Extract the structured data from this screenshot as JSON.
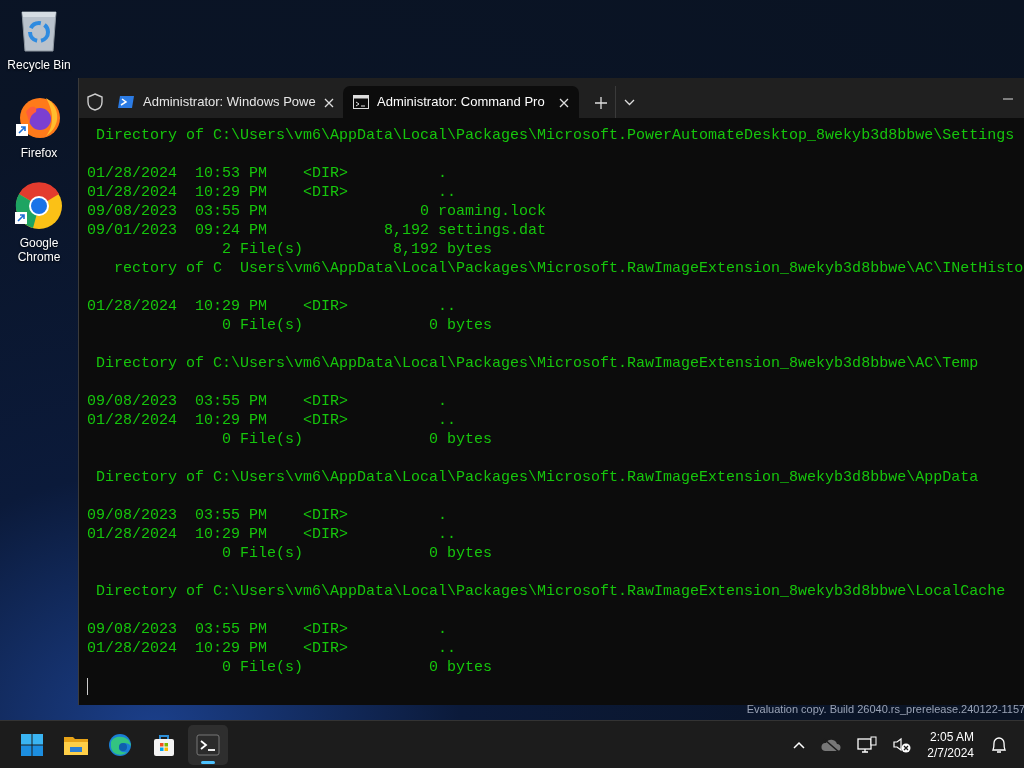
{
  "desktop": {
    "icons": [
      {
        "kind": "recycle-bin",
        "label": "Recycle Bin",
        "shortcut": false
      },
      {
        "kind": "firefox",
        "label": "Firefox",
        "shortcut": true
      },
      {
        "kind": "chrome",
        "label": "Google Chrome",
        "shortcut": true
      }
    ],
    "build_notice": "Evaluation copy. Build 26040.rs_prerelease.240122-1157"
  },
  "terminal": {
    "tabs": [
      {
        "kind": "powershell",
        "title": "Administrator: Windows Powe",
        "selected": false
      },
      {
        "kind": "cmd",
        "title": "Administrator: Command Pro",
        "selected": true
      }
    ],
    "blocks": [
      [
        " Directory of C:\\Users\\vm6\\AppData\\Local\\Packages\\Microsoft.PowerAutomateDesktop_8wekyb3d8bbwe\\Settings"
      ],
      [
        "01/28/2024  10:53 PM    <DIR>          .",
        "01/28/2024  10:29 PM    <DIR>          ..",
        "09/08/2023  03:55 PM                 0 roaming.lock",
        "09/01/2023  09:24 PM             8,192 settings.dat",
        "               2 File(s)          8,192 bytes",
        "   rectory of C  Users\\vm6\\AppData\\Local\\Packages\\Microsoft.RawImageExtension_8wekyb3d8bbwe\\AC\\INetHisto"
      ],
      [
        "01/28/2024  10:29 PM    <DIR>          ..",
        "               0 File(s)              0 bytes"
      ],
      [
        " Directory of C:\\Users\\vm6\\AppData\\Local\\Packages\\Microsoft.RawImageExtension_8wekyb3d8bbwe\\AC\\Temp"
      ],
      [
        "09/08/2023  03:55 PM    <DIR>          .",
        "01/28/2024  10:29 PM    <DIR>          ..",
        "               0 File(s)              0 bytes"
      ],
      [
        " Directory of C:\\Users\\vm6\\AppData\\Local\\Packages\\Microsoft.RawImageExtension_8wekyb3d8bbwe\\AppData"
      ],
      [
        "09/08/2023  03:55 PM    <DIR>          .",
        "01/28/2024  10:29 PM    <DIR>          ..",
        "               0 File(s)              0 bytes"
      ],
      [
        " Directory of C:\\Users\\vm6\\AppData\\Local\\Packages\\Microsoft.RawImageExtension_8wekyb3d8bbwe\\LocalCache"
      ],
      [
        "09/08/2023  03:55 PM    <DIR>          .",
        "01/28/2024  10:29 PM    <DIR>          ..",
        "               0 File(s)              0 bytes"
      ]
    ]
  },
  "taskbar": {
    "apps": [
      {
        "kind": "start",
        "selected": false
      },
      {
        "kind": "explorer",
        "selected": false
      },
      {
        "kind": "edge",
        "selected": false
      },
      {
        "kind": "store",
        "selected": false
      },
      {
        "kind": "terminal",
        "selected": true
      }
    ],
    "clock": {
      "time": "2:05 AM",
      "date": "2/7/2024"
    }
  }
}
